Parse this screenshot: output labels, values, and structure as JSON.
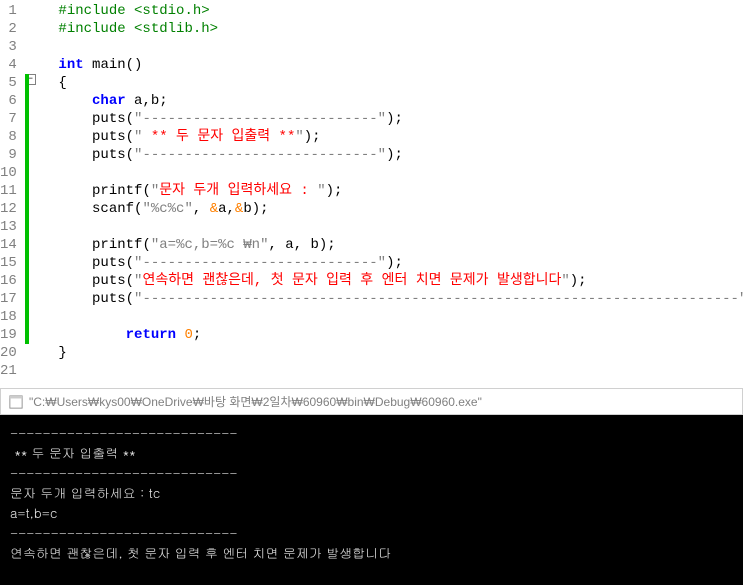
{
  "lines": [
    {
      "n": "1",
      "seg": [
        {
          "c": "pre",
          "t": "#include <stdio.h>"
        }
      ],
      "ind": 1
    },
    {
      "n": "2",
      "seg": [
        {
          "c": "pre",
          "t": "#include <stdlib.h>"
        }
      ],
      "ind": 1
    },
    {
      "n": "3",
      "seg": [],
      "ind": 0
    },
    {
      "n": "4",
      "seg": [
        {
          "c": "kw",
          "t": "int"
        },
        {
          "c": "text",
          "t": " main"
        },
        {
          "c": "punct",
          "t": "()"
        }
      ],
      "ind": 1
    },
    {
      "n": "5",
      "seg": [
        {
          "c": "punct",
          "t": "{"
        }
      ],
      "ind": 1
    },
    {
      "n": "6",
      "seg": [
        {
          "c": "kw",
          "t": "char"
        },
        {
          "c": "text",
          "t": " a"
        },
        {
          "c": "punct",
          "t": ","
        },
        {
          "c": "text",
          "t": "b"
        },
        {
          "c": "punct",
          "t": ";"
        }
      ],
      "ind": 2
    },
    {
      "n": "7",
      "seg": [
        {
          "c": "text",
          "t": "puts"
        },
        {
          "c": "punct",
          "t": "("
        },
        {
          "c": "str",
          "t": "\"----------------------------\""
        },
        {
          "c": "punct",
          "t": ");"
        }
      ],
      "ind": 2
    },
    {
      "n": "8",
      "seg": [
        {
          "c": "text",
          "t": "puts"
        },
        {
          "c": "punct",
          "t": "("
        },
        {
          "c": "str",
          "t": "\""
        },
        {
          "c": "str-red",
          "t": " ** 두 문자 입출력 **"
        },
        {
          "c": "str",
          "t": "\""
        },
        {
          "c": "punct",
          "t": ");"
        }
      ],
      "ind": 2
    },
    {
      "n": "9",
      "seg": [
        {
          "c": "text",
          "t": "puts"
        },
        {
          "c": "punct",
          "t": "("
        },
        {
          "c": "str",
          "t": "\"----------------------------\""
        },
        {
          "c": "punct",
          "t": ");"
        }
      ],
      "ind": 2
    },
    {
      "n": "10",
      "seg": [],
      "ind": 0
    },
    {
      "n": "11",
      "seg": [
        {
          "c": "text",
          "t": "printf"
        },
        {
          "c": "punct",
          "t": "("
        },
        {
          "c": "str",
          "t": "\""
        },
        {
          "c": "str-red",
          "t": "문자 두개 입력하세요 : "
        },
        {
          "c": "str",
          "t": "\""
        },
        {
          "c": "punct",
          "t": ");"
        }
      ],
      "ind": 2
    },
    {
      "n": "12",
      "seg": [
        {
          "c": "text",
          "t": "scanf"
        },
        {
          "c": "punct",
          "t": "("
        },
        {
          "c": "str",
          "t": "\"%c%c\""
        },
        {
          "c": "punct",
          "t": ", "
        },
        {
          "c": "amp",
          "t": "&"
        },
        {
          "c": "text",
          "t": "a"
        },
        {
          "c": "punct",
          "t": ","
        },
        {
          "c": "amp",
          "t": "&"
        },
        {
          "c": "text",
          "t": "b"
        },
        {
          "c": "punct",
          "t": ");"
        }
      ],
      "ind": 2
    },
    {
      "n": "13",
      "seg": [],
      "ind": 0
    },
    {
      "n": "14",
      "seg": [
        {
          "c": "text",
          "t": "printf"
        },
        {
          "c": "punct",
          "t": "("
        },
        {
          "c": "str",
          "t": "\"a=%c,b=%c ₩n\""
        },
        {
          "c": "punct",
          "t": ", a, b);"
        }
      ],
      "ind": 2
    },
    {
      "n": "15",
      "seg": [
        {
          "c": "text",
          "t": "puts"
        },
        {
          "c": "punct",
          "t": "("
        },
        {
          "c": "str",
          "t": "\"----------------------------\""
        },
        {
          "c": "punct",
          "t": ");"
        }
      ],
      "ind": 2
    },
    {
      "n": "16",
      "seg": [
        {
          "c": "text",
          "t": "puts"
        },
        {
          "c": "punct",
          "t": "("
        },
        {
          "c": "str",
          "t": "\""
        },
        {
          "c": "str-red",
          "t": "연속하면 괜찮은데, 첫 문자 입력 후 엔터 치면 문제가 발생합니다"
        },
        {
          "c": "str",
          "t": "\""
        },
        {
          "c": "punct",
          "t": ");"
        }
      ],
      "ind": 2
    },
    {
      "n": "17",
      "seg": [
        {
          "c": "text",
          "t": "puts"
        },
        {
          "c": "punct",
          "t": "("
        },
        {
          "c": "str",
          "t": "\"-----------------------------------------------------------------------\""
        },
        {
          "c": "punct",
          "t": ");"
        }
      ],
      "ind": 2
    },
    {
      "n": "18",
      "seg": [],
      "ind": 0
    },
    {
      "n": "19",
      "seg": [
        {
          "c": "kw",
          "t": "return"
        },
        {
          "c": "text",
          "t": " "
        },
        {
          "c": "num",
          "t": "0"
        },
        {
          "c": "punct",
          "t": ";"
        }
      ],
      "ind": 3
    },
    {
      "n": "20",
      "seg": [
        {
          "c": "punct",
          "t": "}"
        }
      ],
      "ind": 1
    },
    {
      "n": "21",
      "seg": [],
      "ind": 0
    }
  ],
  "fold_symbol": "−",
  "title_path": "\"C:₩Users₩kys00₩OneDrive₩바탕 화면₩2일차₩60960₩bin₩Debug₩60960.exe\"",
  "console_lines": [
    "----------------------------",
    " ** 두 문자 입출력 **",
    "----------------------------",
    "문자 두개 입력하세요 : tc",
    "a=t,b=c",
    "----------------------------",
    "연속하면 괜찮은데, 첫 문자 입력 후 엔터 치면 문제가 발생합니다"
  ]
}
